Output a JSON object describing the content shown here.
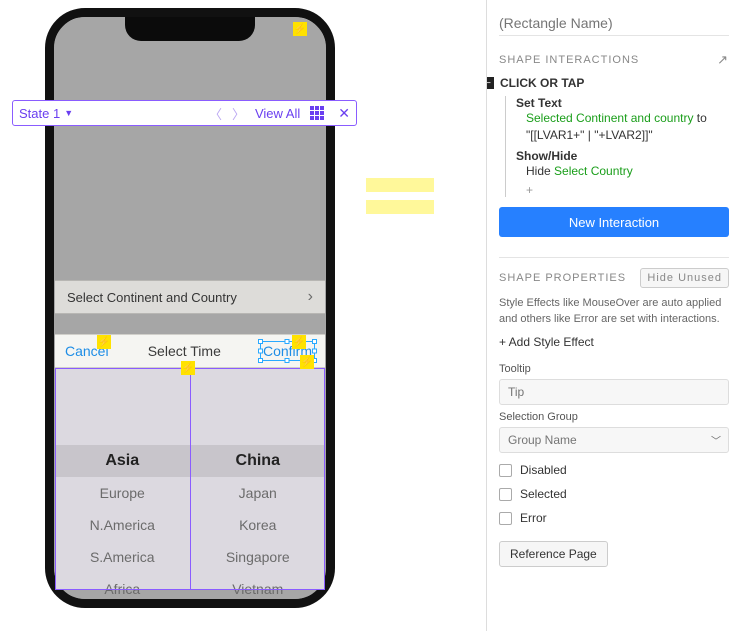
{
  "canvas": {
    "state_label": "State 1",
    "view_all": "View All",
    "select_row": "Select Continent and Country",
    "picker": {
      "cancel": "Cancel",
      "title": "Select Time",
      "confirm": "Confirm",
      "left": [
        "Asia",
        "Europe",
        "N.America",
        "S.America",
        "Africa"
      ],
      "right": [
        "China",
        "Japan",
        "Korea",
        "Singapore",
        "Vietnam"
      ]
    }
  },
  "panel": {
    "name_placeholder": "(Rectangle Name)",
    "shape_interactions": "SHAPE INTERACTIONS",
    "event": "CLICK OR TAP",
    "action1": {
      "name": "Set Text",
      "target": "Selected Continent and country",
      "to_word": " to",
      "expr": "\"[[LVAR1+\" | \"+LVAR2]]\""
    },
    "action2": {
      "name": "Show/Hide",
      "verb": "Hide ",
      "target": "Select Country"
    },
    "new_interaction": "New Interaction",
    "shape_properties": "SHAPE PROPERTIES",
    "hide_unused": "Hide Unused",
    "helper": "Style Effects like MouseOver are auto applied and others like Error are set with interactions.",
    "add_style": "+ Add Style Effect",
    "tooltip_label": "Tooltip",
    "tooltip_placeholder": "Tip",
    "selgroup_label": "Selection Group",
    "selgroup_placeholder": "Group Name",
    "disabled": "Disabled",
    "selected": "Selected",
    "error": "Error",
    "reference_page": "Reference Page"
  }
}
